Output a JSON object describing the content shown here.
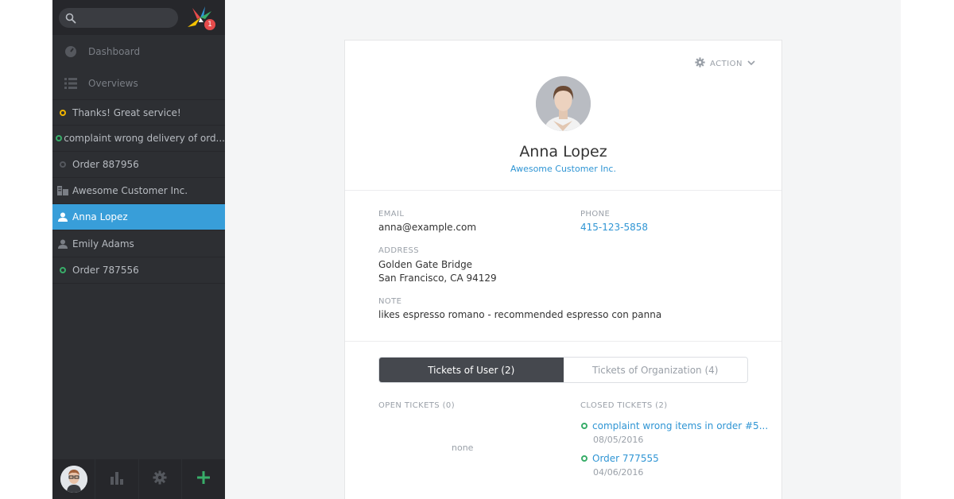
{
  "sidebar": {
    "nav": [
      {
        "label": "Dashboard",
        "icon": "dashboard-icon"
      },
      {
        "label": "Overviews",
        "icon": "list-icon"
      }
    ],
    "notification_count": "1",
    "tasks": [
      {
        "label": "Thanks! Great service!",
        "icon": "ticket-open-icon",
        "color": "#f0b400"
      },
      {
        "label": "complaint wrong delivery of ord...",
        "icon": "ticket-open-icon",
        "color": "#38ad69"
      },
      {
        "label": "Order 887956",
        "icon": "ticket-closed-icon",
        "color": "#55585e"
      },
      {
        "label": "Awesome Customer Inc.",
        "icon": "organization-icon"
      },
      {
        "label": "Anna Lopez",
        "icon": "user-icon",
        "active": true
      },
      {
        "label": "Emily Adams",
        "icon": "user-icon"
      },
      {
        "label": "Order 787556",
        "icon": "ticket-open-icon",
        "color": "#38ad69"
      }
    ],
    "bottom": [
      "avatar",
      "stats-icon",
      "gear-icon",
      "plus-icon"
    ]
  },
  "profile": {
    "action_label": "ACTION",
    "name": "Anna Lopez",
    "organization": "Awesome Customer Inc.",
    "email_label": "EMAIL",
    "email": "anna@example.com",
    "phone_label": "PHONE",
    "phone": "415-123-5858",
    "address_label": "ADDRESS",
    "address_line1": "Golden Gate Bridge",
    "address_line2": "San Francisco, CA 94129",
    "note_label": "NOTE",
    "note": "likes espresso romano - recommended espresso con panna"
  },
  "tickets": {
    "tab_user": "Tickets of User (2)",
    "tab_org": "Tickets of Organization (4)",
    "open_label": "OPEN TICKETS (0)",
    "open_empty": "none",
    "closed_label": "CLOSED TICKETS (2)",
    "closed": [
      {
        "title": "complaint wrong items in order #5...",
        "date": "08/05/2016"
      },
      {
        "title": "Order 777555",
        "date": "04/06/2016"
      }
    ]
  },
  "colors": {
    "accent": "#389ed9",
    "link": "#2f95d4",
    "open_green": "#38ad69",
    "pending_yellow": "#f0b400",
    "badge_red": "#e54b4b"
  }
}
